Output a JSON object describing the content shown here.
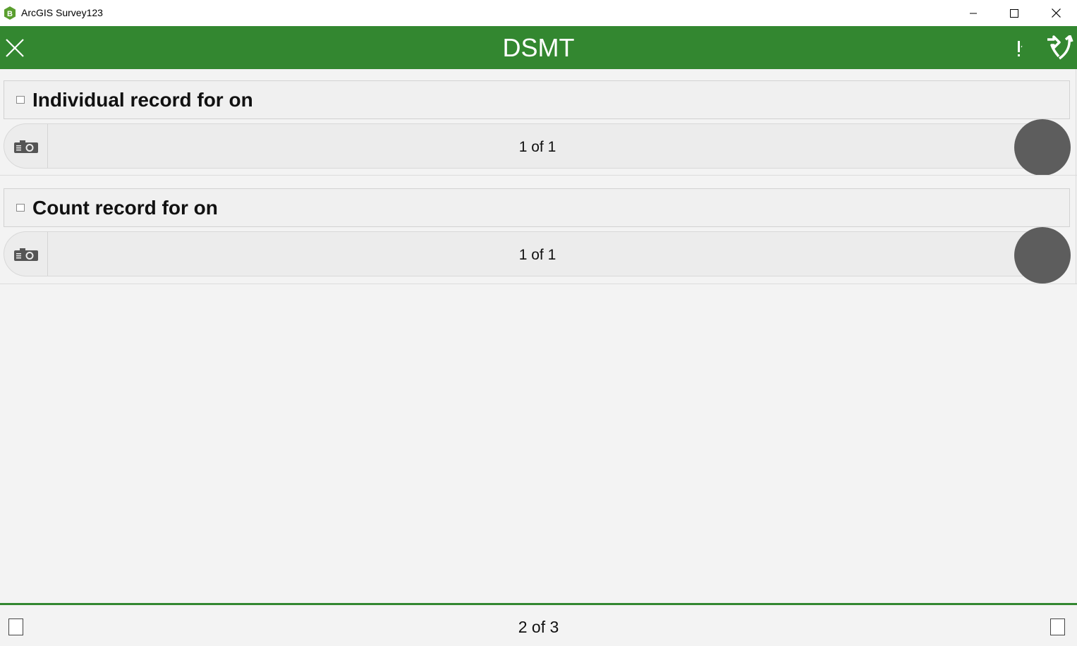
{
  "window": {
    "title": "ArcGIS Survey123",
    "logo_letter": "B",
    "minimize_label": "",
    "maximize_label": "",
    "close_label": ""
  },
  "header": {
    "title": "DSMT",
    "close_icon": "close-icon",
    "alert_icon": "exclamation-icon",
    "submit_icon": "send-icon",
    "background_color": "#338730"
  },
  "sections": [
    {
      "title": "Individual record for on",
      "record_counter": "1 of 1",
      "photo_icon": "camera-icon"
    },
    {
      "title": "Count record for on",
      "record_counter": "1 of 1",
      "photo_icon": "camera-icon"
    }
  ],
  "footer": {
    "page_counter": "2 of 3",
    "prev_icon": "previous-page-icon",
    "next_icon": "next-page-icon"
  }
}
